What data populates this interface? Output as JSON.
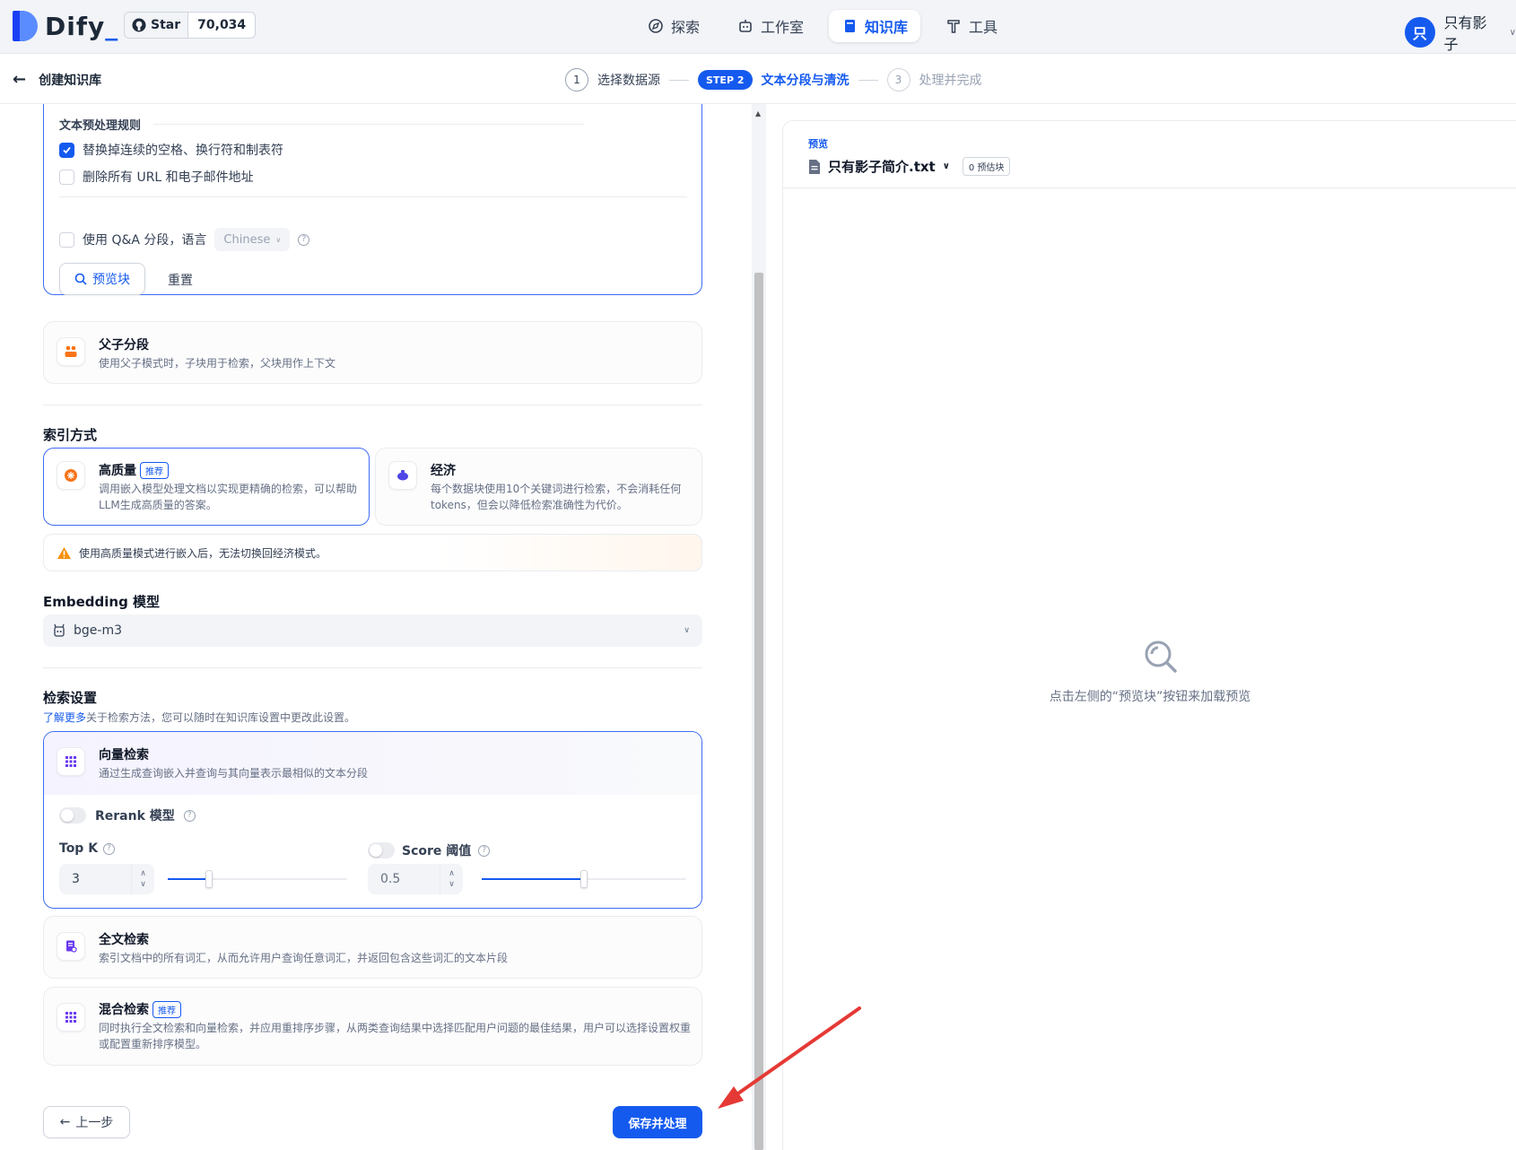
{
  "header": {
    "logo_text": "Dify",
    "star_label": "Star",
    "star_count": "70,034",
    "nav": [
      "探索",
      "工作室",
      "知识库",
      "工具"
    ],
    "user_initial": "只",
    "user_name": "只有影子"
  },
  "subheader": {
    "back_label": "创建知识库",
    "steps": {
      "s1_num": "1",
      "s1_label": "选择数据源",
      "s2_pill": "STEP 2",
      "s2_label": "文本分段与清洗",
      "s3_num": "3",
      "s3_label": "处理并完成"
    }
  },
  "preprocess": {
    "title": "文本预处理规则",
    "rule1": "替换掉连续的空格、换行符和制表符",
    "rule1_checked": true,
    "rule2": "删除所有 URL 和电子邮件地址",
    "rule2_checked": false,
    "qa_label": "使用 Q&A 分段，语言",
    "qa_lang": "Chinese",
    "preview_button": "预览块",
    "reset_button": "重置"
  },
  "parent_child": {
    "title": "父子分段",
    "desc": "使用父子模式时，子块用于检索，父块用作上下文"
  },
  "index": {
    "title": "索引方式",
    "high": {
      "title": "高质量",
      "badge": "推荐",
      "desc": "调用嵌入模型处理文档以实现更精确的检索，可以帮助LLM生成高质量的答案。"
    },
    "eco": {
      "title": "经济",
      "desc": "每个数据块使用10个关键词进行检索，不会消耗任何tokens，但会以降低检索准确性为代价。"
    },
    "warning": "使用高质量模式进行嵌入后，无法切换回经济模式。"
  },
  "embedding": {
    "title": "Embedding 模型",
    "model": "bge-m3"
  },
  "retrieval": {
    "title": "检索设置",
    "learn_more": "了解更多",
    "desc": "关于检索方法，您可以随时在知识库设置中更改此设置。",
    "vector": {
      "title": "向量检索",
      "desc": "通过生成查询嵌入并查询与其向量表示最相似的文本分段"
    },
    "rerank_label": "Rerank 模型",
    "topk_label": "Top K",
    "topk_value": "3",
    "topk_fraction": 0.23,
    "score_label": "Score 阈值",
    "score_value": "0.5",
    "score_fraction": 0.5,
    "fulltext": {
      "title": "全文检索",
      "desc": "索引文档中的所有词汇，从而允许用户查询任意词汇，并返回包含这些词汇的文本片段"
    },
    "hybrid": {
      "title": "混合检索",
      "badge": "推荐",
      "desc": "同时执行全文检索和向量检索，并应用重排序步骤，从两类查询结果中选择匹配用户问题的最佳结果，用户可以选择设置权重或配置重新排序模型。"
    }
  },
  "footer": {
    "prev_button": "上一步",
    "save_button": "保存并处理"
  },
  "preview": {
    "label": "预览",
    "file_name": "只有影子简介.txt",
    "chunk_count": "0 预估块",
    "empty_hint": "点击左侧的“预览块”按钮来加载预览"
  },
  "colors": {
    "accent": "#155aef",
    "annotation_arrow": "#e53935",
    "warning": "#f79009"
  }
}
